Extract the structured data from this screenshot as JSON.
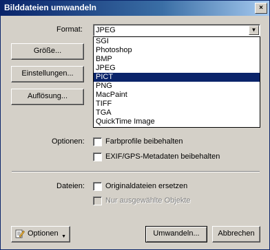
{
  "window": {
    "title": "Bilddateien umwandeln",
    "close_symbol": "×"
  },
  "left_buttons": {
    "size": "Größe...",
    "settings": "Einstellungen...",
    "resolution": "Auflösung..."
  },
  "format": {
    "label": "Format:",
    "selected": "JPEG",
    "options": [
      "SGI",
      "Photoshop",
      "BMP",
      "JPEG",
      "PICT",
      "PNG",
      "MacPaint",
      "TIFF",
      "TGA",
      "QuickTime Image"
    ],
    "highlighted": "PICT"
  },
  "options_section": {
    "label": "Optionen:",
    "keep_color_profiles": "Farbprofile beibehalten",
    "keep_exif_gps": "EXIF/GPS-Metadaten beibehalten"
  },
  "files_section": {
    "label": "Dateien:",
    "replace_originals": "Originaldateien ersetzen",
    "only_selected": "Nur ausgewählte Objekte"
  },
  "bottom": {
    "options_button": "Optionen",
    "convert": "Umwandeln...",
    "cancel": "Abbrechen"
  }
}
